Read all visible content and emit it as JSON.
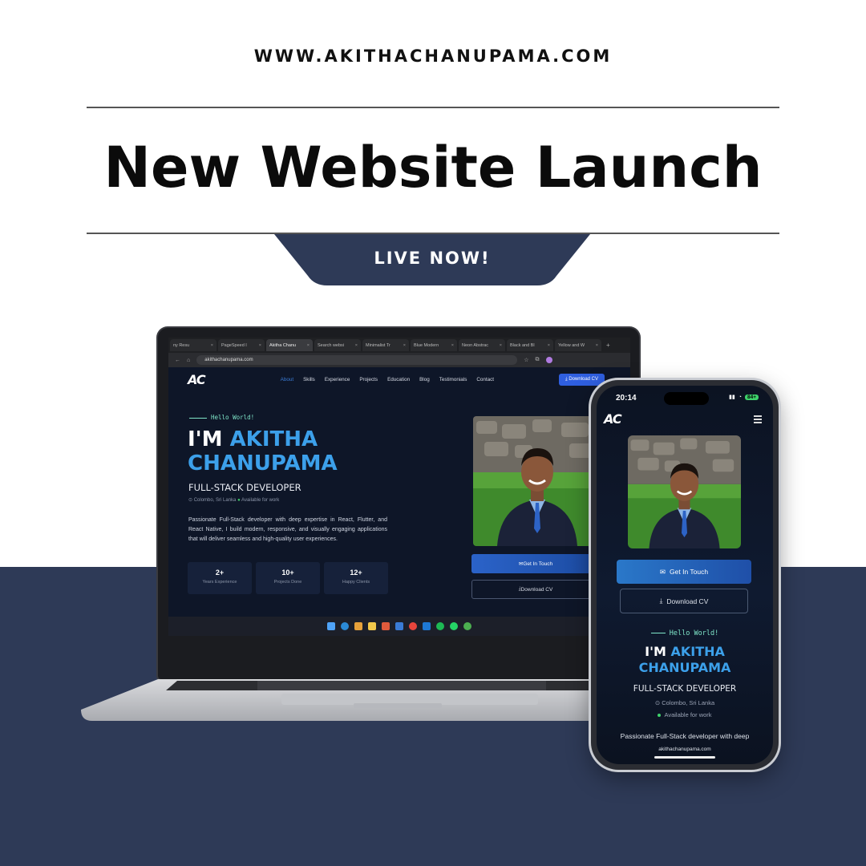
{
  "header": {
    "url": "WWW.AKITHACHANUPAMA.COM",
    "headline": "New Website Launch",
    "badge": "LIVE NOW!"
  },
  "colors": {
    "navy": "#2e3a57",
    "accent_blue": "#3ca0ea",
    "mint": "#7fe6c9",
    "site_bg": "#0e1628"
  },
  "browser": {
    "tabs": [
      {
        "label": "ny Resu",
        "active": false
      },
      {
        "label": "PageSpeed I",
        "active": false
      },
      {
        "label": "Akitha Chanu",
        "active": true
      },
      {
        "label": "Search websi",
        "active": false
      },
      {
        "label": "Minimalist Tr",
        "active": false
      },
      {
        "label": "Blue Modern",
        "active": false
      },
      {
        "label": "Neon Abstrac",
        "active": false
      },
      {
        "label": "Black and Bl",
        "active": false
      },
      {
        "label": "Yellow and W",
        "active": false
      }
    ],
    "address": "akithachanupama.com"
  },
  "site": {
    "logo": "AC",
    "nav": [
      "About",
      "Skills",
      "Experience",
      "Projects",
      "Education",
      "Blog",
      "Testimonials",
      "Contact"
    ],
    "download_cv_nav": "Download CV",
    "hello": "Hello World!",
    "hero_prefix": "I'M ",
    "hero_first": "AKITHA",
    "hero_last": "CHANUPAMA",
    "role": "FULL-STACK DEVELOPER",
    "location": "Colombo, Sri Lanka",
    "availability": "Available for work",
    "description": "Passionate Full-Stack developer with deep expertise in React, Flutter, and React Native, I build modern, responsive, and visually engaging applications that will deliver seamless and high-quality user experiences.",
    "stats": [
      {
        "value": "2+",
        "label": "Years Experience"
      },
      {
        "value": "10+",
        "label": "Projects Done"
      },
      {
        "value": "12+",
        "label": "Happy Clients"
      }
    ],
    "get_in_touch": "Get In Touch",
    "download_cv": "Download CV"
  },
  "phone": {
    "time": "20:14",
    "battery": "84+",
    "description_line": "Passionate Full-Stack developer with deep",
    "url": "akithachanupama.com"
  }
}
